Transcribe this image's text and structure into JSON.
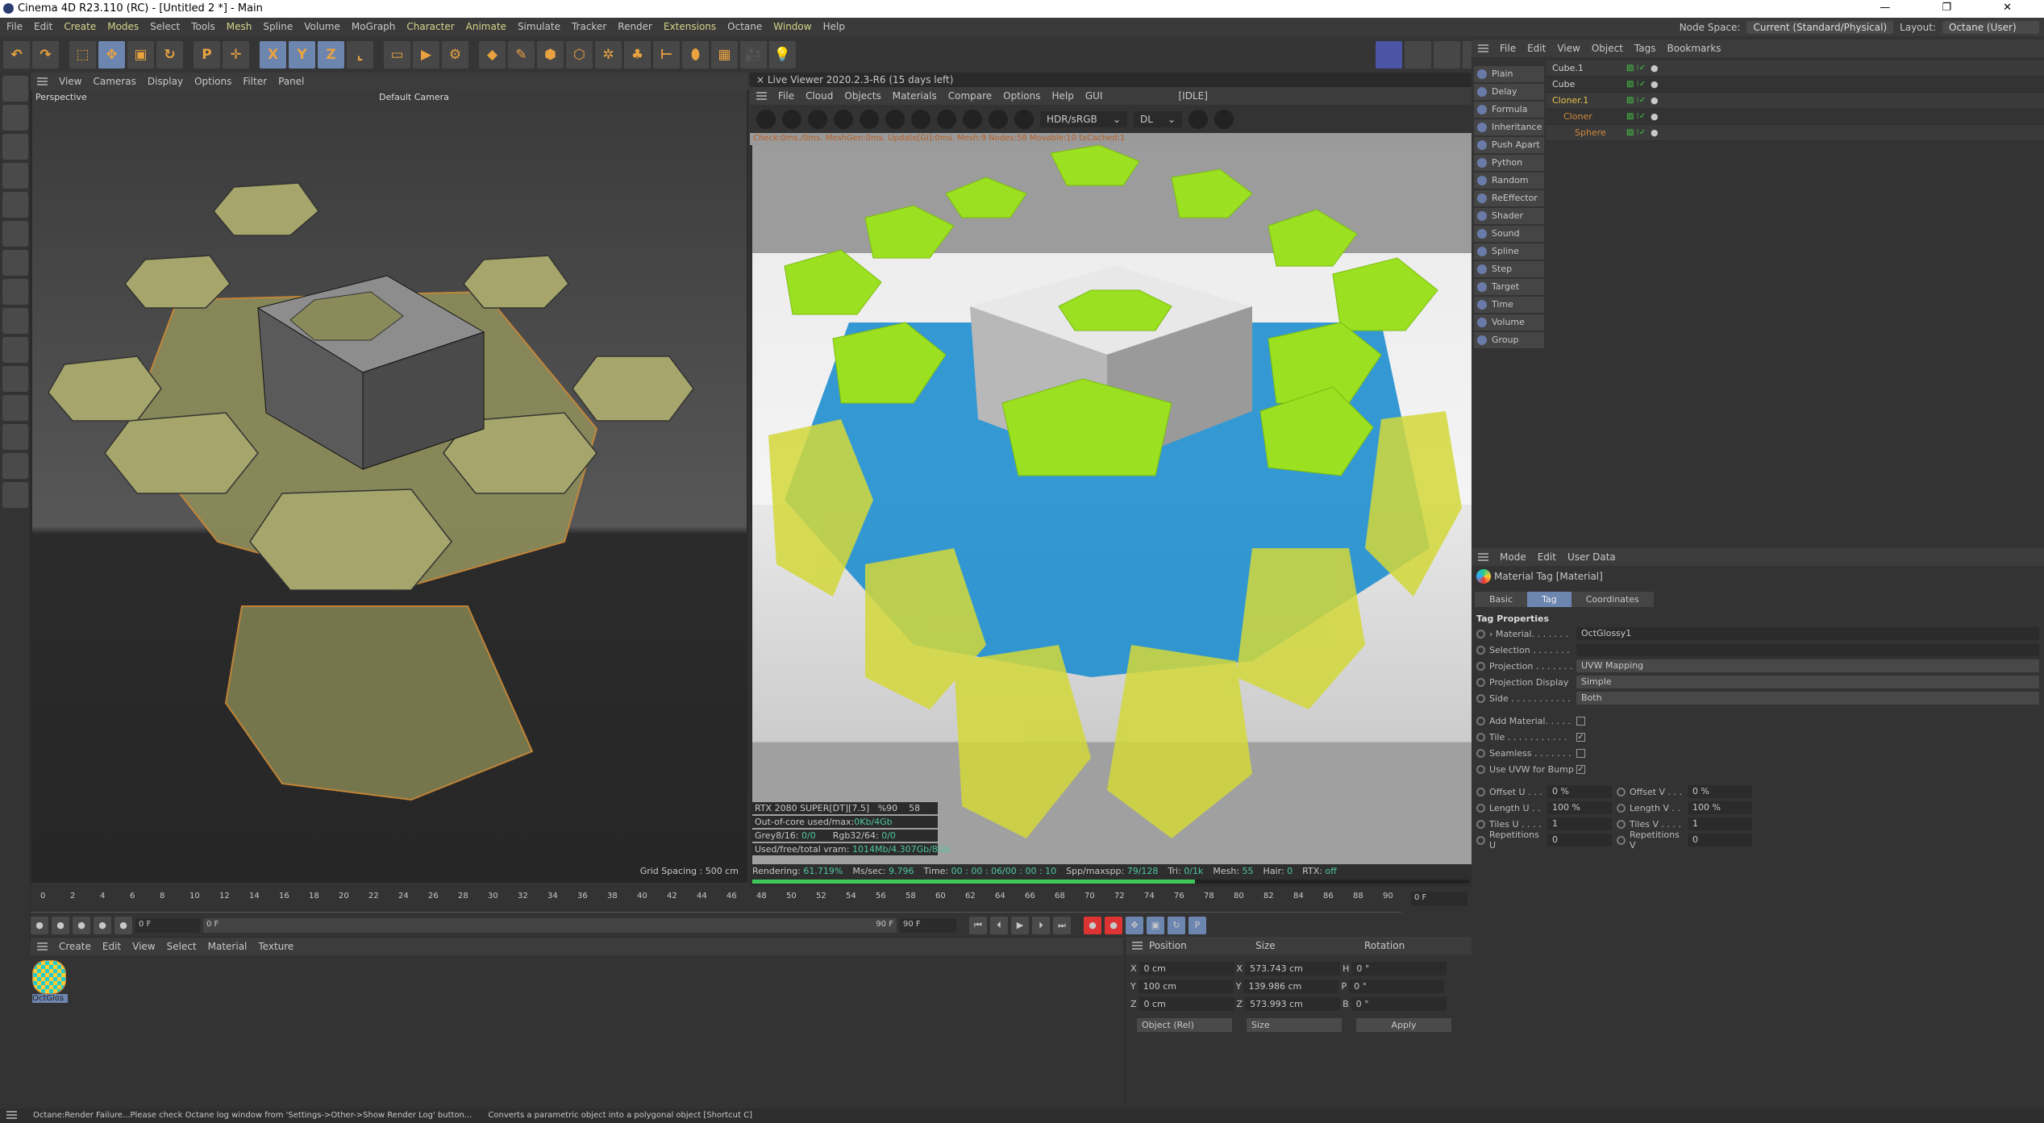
{
  "window": {
    "title": "Cinema 4D R23.110 (RC) - [Untitled 2 *] - Main",
    "controls": "— ❐ ✕"
  },
  "menu": [
    "File",
    "Edit",
    "Create",
    "Modes",
    "Select",
    "Tools",
    "Mesh",
    "Spline",
    "Volume",
    "MoGraph",
    "Character",
    "Animate",
    "Simulate",
    "Tracker",
    "Render",
    "Extensions",
    "Octane",
    "Window",
    "Help"
  ],
  "menu_highlight": [
    "Create",
    "Modes",
    "Mesh",
    "Character",
    "Animate",
    "Extensions",
    "Window"
  ],
  "node_space": {
    "label": "Node Space:",
    "value": "Current (Standard/Physical)",
    "layout_label": "Layout:",
    "layout_value": "Octane (User)"
  },
  "toolbar": [
    "undo",
    "redo",
    "live-select",
    "move",
    "scale",
    "rotate",
    "psr",
    "axis",
    "X",
    "Y",
    "Z",
    "coord-system",
    "render-view",
    "render",
    "render-settings",
    "cube",
    "pen",
    "subdivision",
    "extrude",
    "cloner",
    "mograph",
    "deformer",
    "effector",
    "floor",
    "camera",
    "light"
  ],
  "viewport": {
    "menu": [
      "View",
      "Cameras",
      "Display",
      "Options",
      "Filter",
      "Panel"
    ],
    "view_name": "Perspective",
    "camera": "Default Camera",
    "grid": "Grid Spacing : 500 cm"
  },
  "live_viewer": {
    "title": "Live Viewer 2020.2.3-R6 (15 days left)",
    "menu": [
      "File",
      "Cloud",
      "Objects",
      "Materials",
      "Compare",
      "Options",
      "Help",
      "GUI"
    ],
    "state": "[IDLE]",
    "color_mode": "HDR/sRGB",
    "kernel": "DL",
    "stat_line": "Check:0ms./0ms. MeshGen:0ms. Update[GI]:0ms. Mesh:9 Nodes:58 Movable:10 txCached:1",
    "gpu": "RTX 2080 SUPER[DT][7.5]",
    "gpu_pct": "%90",
    "gpu_temp": "58",
    "ooc_label": "Out-of-core used/max:",
    "ooc": "0Kb/4Gb",
    "grey_label": "Grey8/16:",
    "grey": "0/0",
    "rgb_label": "Rgb32/64:",
    "rgb": "0/0",
    "vram_label": "Used/free/total vram:",
    "vram": "1014Mb/4.307Gb/8Gb",
    "status": [
      [
        "Rendering:",
        "61.719%"
      ],
      [
        "Ms/sec:",
        "9.796"
      ],
      [
        "Time:",
        "00 : 00 : 06/00 : 00 : 10"
      ],
      [
        "Spp/maxspp:",
        "79/128"
      ],
      [
        "Tri:",
        "0/1k"
      ],
      [
        "Mesh:",
        "55"
      ],
      [
        "Hair:",
        "0"
      ],
      [
        "RTX:",
        "off"
      ]
    ],
    "progress_pct": 61.719
  },
  "objects": {
    "menu": [
      "File",
      "Edit",
      "View",
      "Object",
      "Tags",
      "Bookmarks"
    ],
    "effectors": [
      "Plain",
      "Delay",
      "Formula",
      "Inheritance",
      "Push Apart",
      "Python",
      "Random",
      "ReEffector",
      "Shader",
      "Sound",
      "Spline",
      "Step",
      "Target",
      "Time",
      "Volume",
      "Group"
    ],
    "tree": [
      {
        "name": "Cube.1",
        "indent": 0,
        "color": "#cfcfcf"
      },
      {
        "name": "Cube",
        "indent": 0,
        "color": "#cfcfcf"
      },
      {
        "name": "Cloner.1",
        "indent": 0,
        "color": "#e8c04a"
      },
      {
        "name": "Cloner",
        "indent": 1,
        "color": "#d08a3a"
      },
      {
        "name": "Sphere",
        "indent": 2,
        "color": "#d08a3a"
      }
    ]
  },
  "attributes": {
    "menu": [
      "Mode",
      "Edit",
      "User Data"
    ],
    "header": "Material Tag [Material]",
    "tabs": [
      "Basic",
      "Tag",
      "Coordinates"
    ],
    "active_tab": "Tag",
    "section": "Tag Properties",
    "fields": [
      {
        "label": "› Material. . . . . . .",
        "value": "OctGlossy1"
      },
      {
        "label": "Selection . . . . . . .",
        "value": ""
      },
      {
        "label": "Projection . . . . . . .",
        "value": "UVW Mapping"
      },
      {
        "label": "Projection Display",
        "value": "Simple"
      },
      {
        "label": "Side . . . . . . . . . . .",
        "value": "Both"
      }
    ],
    "checks": [
      {
        "label": "Add Material. . . . .",
        "checked": false
      },
      {
        "label": "Tile . . . . . . . . . . .",
        "checked": true
      },
      {
        "label": "Seamless . . . . . . .",
        "checked": false
      },
      {
        "label": "Use UVW for Bump",
        "checked": true
      }
    ],
    "pairs": [
      [
        "Offset U . . .",
        "0 %",
        "Offset V . . .",
        "0 %"
      ],
      [
        "Length U . .",
        "100 %",
        "Length V . .",
        "100 %"
      ],
      [
        "Tiles U . . . .",
        "1",
        "Tiles V . . . .",
        "1"
      ],
      [
        "Repetitions U",
        "0",
        "Repetitions V",
        "0"
      ]
    ]
  },
  "timeline": {
    "ticks": [
      0,
      2,
      4,
      6,
      8,
      10,
      12,
      14,
      16,
      18,
      20,
      22,
      24,
      26,
      28,
      30,
      32,
      34,
      36,
      38,
      40,
      42,
      44,
      46,
      48,
      50,
      52,
      54,
      56,
      58,
      60,
      62,
      64,
      66,
      68,
      70,
      72,
      74,
      76,
      78,
      80,
      82,
      84,
      86,
      88,
      90
    ],
    "current": "0 F",
    "start": "0 F",
    "range_start": "0 F",
    "range_end": "90 F",
    "end": "90 F"
  },
  "materials": {
    "menu": [
      "Create",
      "Edit",
      "View",
      "Select",
      "Material",
      "Texture"
    ],
    "items": [
      "OctGlos"
    ]
  },
  "coords": {
    "headers": [
      "Position",
      "Size",
      "Rotation"
    ],
    "rows": [
      [
        "X",
        "0 cm",
        "X",
        "573.743 cm",
        "H",
        "0 °"
      ],
      [
        "Y",
        "100 cm",
        "Y",
        "139.986 cm",
        "P",
        "0 °"
      ],
      [
        "Z",
        "0 cm",
        "Z",
        "573.993 cm",
        "B",
        "0 °"
      ]
    ],
    "mode": "Object (Rel)",
    "size_mode": "Size",
    "apply": "Apply"
  },
  "statusbar": {
    "left": "Octane:Render Failure...Please check Octane log window from 'Settings->Other->Show Render Log' button...",
    "right": "Converts a parametric object into a polygonal object [Shortcut C]"
  }
}
